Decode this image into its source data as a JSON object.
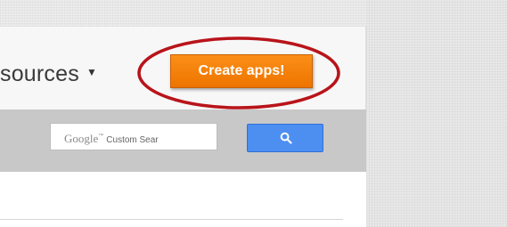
{
  "header": {
    "nav_resources_label": "sources",
    "nav_caret": "▼",
    "create_apps_label": "Create apps!"
  },
  "search": {
    "placeholder_brand": "Google",
    "placeholder_tm": "™",
    "placeholder_text": "Custom Sear",
    "button_icon": "search-icon"
  },
  "colors": {
    "accent_orange": "#f5820f",
    "search_blue": "#4d8ff0",
    "highlight_red": "#b8141a",
    "search_bar_gray": "#c8c8c8"
  }
}
